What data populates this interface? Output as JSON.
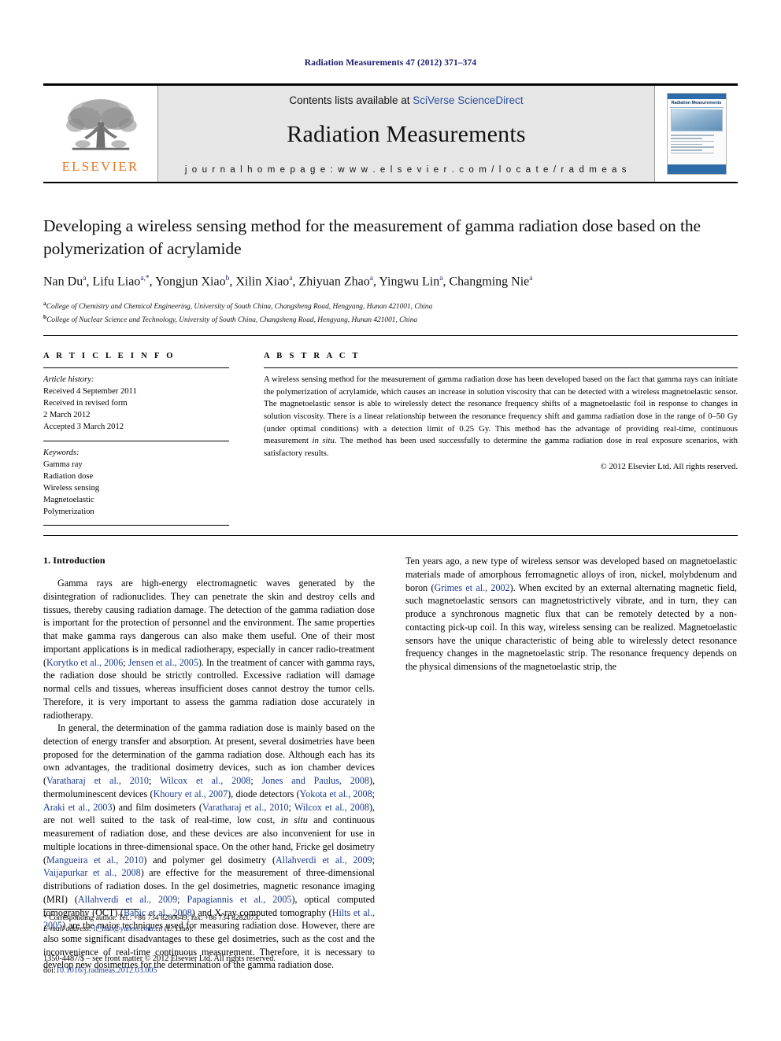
{
  "running_head": "Radiation Measurements 47 (2012) 371–374",
  "masthead": {
    "publisher_name": "ELSEVIER",
    "contents_prefix": "Contents lists available at ",
    "contents_link": "SciVerse ScienceDirect",
    "journal_name": "Radiation Measurements",
    "homepage": "j o u r n a l   h o m e p a g e :   w w w . e l s e v i e r . c o m / l o c a t e / r a d m e a s",
    "cover_title": "Radiation Measurements"
  },
  "article": {
    "title": "Developing a wireless sensing method for the measurement of gamma radiation dose based on the polymerization of acrylamide",
    "authors": [
      {
        "name": "Nan Du",
        "sup": "a"
      },
      {
        "name": "Lifu Liao",
        "sup": "a,*"
      },
      {
        "name": "Yongjun Xiao",
        "sup": "b"
      },
      {
        "name": "Xilin Xiao",
        "sup": "a"
      },
      {
        "name": "Zhiyuan Zhao",
        "sup": "a"
      },
      {
        "name": "Yingwu Lin",
        "sup": "a"
      },
      {
        "name": "Changming Nie",
        "sup": "a"
      }
    ],
    "affiliations": [
      {
        "label": "a",
        "text": "College of Chemistry and Chemical Engineering, University of South China, Changsheng Road, Hengyang, Hunan 421001, China"
      },
      {
        "label": "b",
        "text": "College of Nuclear Science and Technology, University of South China, Changsheng Road, Hengyang, Hunan 421001, China"
      }
    ]
  },
  "article_info": {
    "heading": "A R T I C L E  I N F O",
    "history_label": "Article history:",
    "history": [
      "Received 4 September 2011",
      "Received in revised form",
      "2 March 2012",
      "Accepted 3 March 2012"
    ],
    "keywords_label": "Keywords:",
    "keywords": [
      "Gamma ray",
      "Radiation dose",
      "Wireless sensing",
      "Magnetoelastic",
      "Polymerization"
    ]
  },
  "abstract": {
    "heading": "A B S T R A C T",
    "text_part1": "A wireless sensing method for the measurement of gamma radiation dose has been developed based on the fact that gamma rays can initiate the polymerization of acrylamide, which causes an increase in solution viscosity that can be detected with a wireless magnetoelastic sensor. The magnetoelastic sensor is able to wirelessly detect the resonance frequency shifts of a magnetoelastic foil in response to changes in solution viscosity. There is a linear relationship between the resonance frequency shift and gamma radiation dose in the range of 0–50 Gy (under optimal conditions) with a detection limit of 0.25 Gy. This method has the advantage of providing real-time, continuous measurement ",
    "text_italic": "in situ",
    "text_part2": ". The method has been used successfully to determine the gamma radiation dose in real exposure scenarios, with satisfactory results.",
    "copyright": "© 2012 Elsevier Ltd. All rights reserved."
  },
  "introduction": {
    "section_title": "1.  Introduction",
    "p1_a": "Gamma rays are high-energy electromagnetic waves generated by the disintegration of radionuclides. They can penetrate the skin and destroy cells and tissues, thereby causing radiation damage. The detection of the gamma radiation dose is important for the protection of personnel and the environment. The same properties that make gamma rays dangerous can also make them useful. One of their most important applications is in medical radiotherapy, especially in cancer radio-treatment (",
    "p1_cite1": "Korytko et al., 2006",
    "p1_b": "; ",
    "p1_cite2": "Jensen et al., 2005",
    "p1_c": "). In the treatment of cancer with gamma rays, the radiation dose should be strictly controlled. Excessive radiation will damage normal cells and tissues, whereas insufficient doses cannot destroy the tumor cells. Therefore, it is very important to assess the gamma radiation dose accurately in radiotherapy.",
    "p2_a": "In general, the determination of the gamma radiation dose is mainly based on the detection of energy transfer and absorption. At present, several dosimetries have been proposed for the determination of the gamma radiation dose. Although each has its own advantages, the traditional dosimetry devices, such as ion chamber devices (",
    "p2_cite1": "Varatharaj et al., 2010",
    "p2_sep1": "; ",
    "p2_cite2": "Wilcox et al., 2008",
    "p2_sep2": "; ",
    "p2_cite3": "Jones and Paulus, 2008",
    "p2_b": "), thermoluminescent devices (",
    "p2_cite4": "Khoury et al., 2007",
    "p2_c": "), diode detectors (",
    "p2_cite5": "Yokota et al., 2008",
    "p2_sep3": "; ",
    "p2_cite6": "Araki et al., 2003",
    "p2_d": ") and film dosimeters (",
    "p2_cite7": "Varatharaj et al., 2010",
    "p2_sep4": "; ",
    "p2_cite8": "Wilcox et al., 2008",
    "p2_e": "), are not well suited to the task of real-time, low cost, ",
    "p2_ital1": "in situ",
    "p2_f": " and continuous measurement of radiation dose, and these devices are also inconvenient for use in multiple locations in three-dimensional space. On the other hand, Fricke gel dosimetry (",
    "p2_cite9": "Mangueira et al., 2010",
    "p2_g": ") and polymer gel dosimetry (",
    "p2_cite10": "Allahverdi et al., 2009",
    "p2_sep5": "; ",
    "p2_cite11": "Vaijapurkar et al., 2008",
    "p2_h": ") are effective for the measurement of three-dimensional distributions of radiation doses. In the gel dosimetries, magnetic resonance imaging (MRI) (",
    "p2_cite12": "Allahverdi et al., 2009",
    "p2_sep6": "; ",
    "p2_cite13": "Papagiannis et al., 2005",
    "p2_i": "), optical computed tomography (OCT) (",
    "p2_cite14": "Babic et al., 2008",
    "p2_j": ") and X-ray computed tomography (",
    "p2_cite15": "Hilts et al., 2005",
    "p2_k": ") are the major techniques used for measuring radiation dose. However, there are also some significant disadvantages to these gel dosimetries, such as the cost and the inconvenience of real-time continuous measurement. Therefore, it is necessary to develop new dosimetries for the determination of the gamma radiation dose.",
    "p3_a": "Ten years ago, a new type of wireless sensor was developed based on magnetoelastic materials made of amorphous ferromagnetic alloys of iron, nickel, molybdenum and boron (",
    "p3_cite1": "Grimes et al., 2002",
    "p3_b": "). When excited by an external alternating magnetic field, such magnetoelastic sensors can magnetostrictively vibrate, and in turn, they can produce a synchronous magnetic flux that can be remotely detected by a non-contacting pick-up coil. In this way, wireless sensing can be realized. Magnetoelastic sensors have the unique characteristic of being able to wirelessly detect resonance frequency changes in the magnetoelastic strip. The resonance frequency depends on the physical dimensions of the magnetoelastic strip, the"
  },
  "footnote": {
    "corresponding": "* Corresponding author. Tel.: +86 734 8280649; fax: +86 734 8282073.",
    "email_label": "E-mail address:",
    "email": "lf_liao@yahoo.com.cn",
    "email_owner": "(L. Liao)."
  },
  "footer": {
    "issn_line": "1350-4487/$ – see front matter © 2012 Elsevier Ltd. All rights reserved.",
    "doi_label": "doi:",
    "doi_value": "10.1016/j.radmeas.2012.03.005"
  },
  "colors": {
    "elsevier_orange": "#E87722",
    "link_blue": "#2a4fa2",
    "citation_blue": "#1a3a8f",
    "running_head_blue": "#1a1a6e"
  }
}
